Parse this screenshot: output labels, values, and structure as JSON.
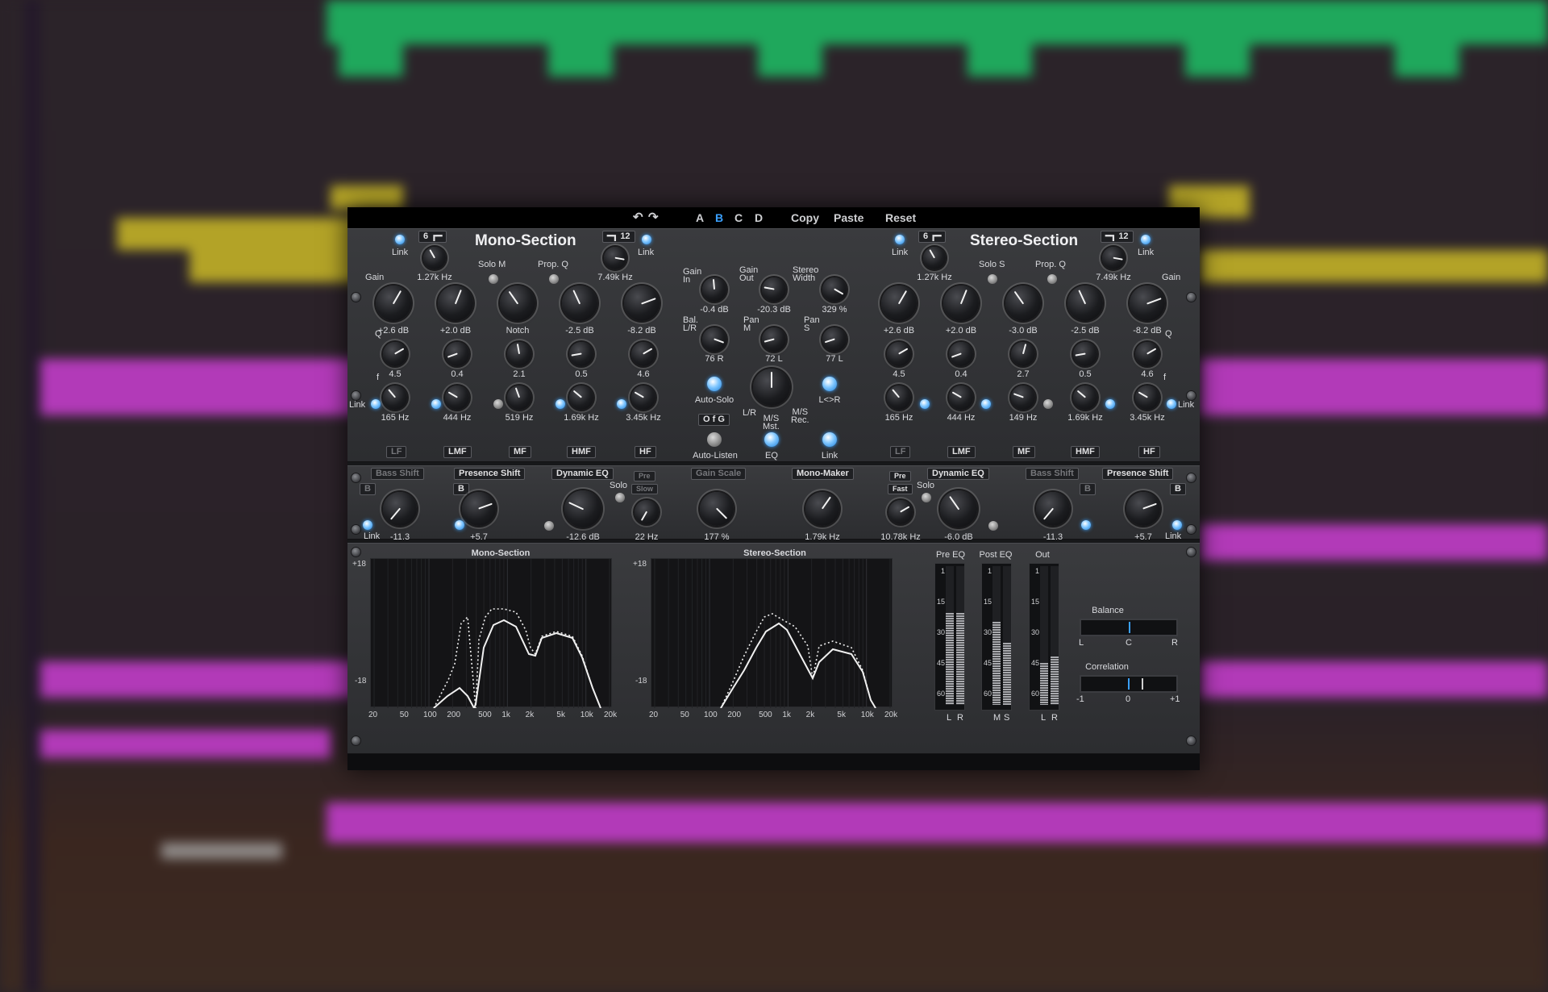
{
  "toolbar": {
    "undo_icon": "undo-icon",
    "redo_icon": "redo-icon",
    "presets": [
      "A",
      "B",
      "C",
      "D"
    ],
    "active_preset": "B",
    "copy": "Copy",
    "paste": "Paste",
    "reset": "Reset",
    "accent": "#3aa0ff"
  },
  "mono": {
    "title": "Mono-Section",
    "link": "Link",
    "hp_slope": "6",
    "hp_freq": "1.27k Hz",
    "lp_slope": "12",
    "lp_freq": "7.49k Hz",
    "solo": "Solo M",
    "propq": "Prop. Q",
    "gain": "Gain",
    "q": "Q",
    "f": "f",
    "gains": [
      "+2.6 dB",
      "+2.0 dB",
      "Notch",
      "-2.5 dB",
      "-8.2 dB"
    ],
    "qs": [
      "4.5",
      "0.4",
      "2.1",
      "0.5",
      "4.6"
    ],
    "freqs": [
      "165 Hz",
      "444 Hz",
      "519 Hz",
      "1.69k Hz",
      "3.45k Hz"
    ],
    "bands": [
      "LF",
      "LMF",
      "MF",
      "HMF",
      "HF"
    ]
  },
  "stereo": {
    "title": "Stereo-Section",
    "link": "Link",
    "hp_slope": "6",
    "hp_freq": "1.27k Hz",
    "lp_slope": "12",
    "lp_freq": "7.49k Hz",
    "solo": "Solo S",
    "propq": "Prop. Q",
    "gain": "Gain",
    "q": "Q",
    "f": "f",
    "gains": [
      "+2.6 dB",
      "+2.0 dB",
      "-3.0 dB",
      "-2.5 dB",
      "-8.2 dB"
    ],
    "qs": [
      "4.5",
      "0.4",
      "2.7",
      "0.5",
      "4.6"
    ],
    "freqs": [
      "165 Hz",
      "444 Hz",
      "149 Hz",
      "1.69k Hz",
      "3.45k Hz"
    ],
    "bands": [
      "LF",
      "LMF",
      "MF",
      "HMF",
      "HF"
    ]
  },
  "center": {
    "gain_in": "Gain\nIn",
    "gain_in_v": "-0.4 dB",
    "gain_out": "Gain\nOut",
    "gain_out_v": "-20.3 dB",
    "stereo_width": "Stereo\nWidth",
    "stereo_width_v": "329 %",
    "bal": "Bal.\nL/R",
    "bal_v": "76 R",
    "pan_m": "Pan\nM",
    "pan_m_v": "72 L",
    "pan_s": "Pan\nS",
    "pan_s_v": "77 L",
    "auto_solo": "Auto-Solo",
    "lr": "L/R",
    "ms_mst": "M/S\nMst.",
    "ms_rec": "M/S\nRec.",
    "lswap": "L<>R",
    "ofg": "O f G",
    "auto_listen": "Auto-Listen",
    "eq": "EQ",
    "link": "Link"
  },
  "dyn": {
    "bass_shift": "Bass Shift",
    "b": "B",
    "presence_shift": "Presence Shift",
    "dynamic_eq": "Dynamic EQ",
    "solo": "Solo",
    "pre": "Pre",
    "slow": "Slow",
    "fast": "Fast",
    "gain_scale": "Gain Scale",
    "mono_maker": "Mono-Maker",
    "link": "Link",
    "values": {
      "bass_m": "-11.3",
      "pres_m": "+5.7",
      "dyn_m": "-12.6 dB",
      "dyn_m_f": "22 Hz",
      "gain_scale": "177 %",
      "mono_maker": "1.79k Hz",
      "dyn_s_f": "10.78k Hz",
      "dyn_s": "-6.0 dB",
      "bass_s": "-11.3",
      "pres_s": "+5.7"
    }
  },
  "graphs": {
    "mono_title": "Mono-Section",
    "stereo_title": "Stereo-Section",
    "ytop": "+18",
    "ybot": "-18",
    "xticks": [
      "20",
      "50",
      "100",
      "200",
      "500",
      "1k",
      "2k",
      "5k",
      "10k",
      "20k"
    ]
  },
  "meters": {
    "pre": "Pre EQ",
    "post": "Post EQ",
    "out": "Out",
    "scale": [
      "1",
      "15",
      "30",
      "45",
      "60"
    ],
    "pre_ch": [
      "L",
      "R"
    ],
    "post_ch": [
      "M",
      "S"
    ],
    "out_ch": [
      "L",
      "R"
    ],
    "levels": {
      "pre": [
        0.66,
        0.66
      ],
      "post": [
        0.6,
        0.45
      ],
      "out": [
        0.3,
        0.35
      ]
    }
  },
  "balance": {
    "title": "Balance",
    "l": "L",
    "c": "C",
    "r": "R",
    "value": 0.02
  },
  "correlation": {
    "title": "Correlation",
    "min": "-1",
    "mid": "0",
    "max": "+1",
    "value": 0.3
  }
}
